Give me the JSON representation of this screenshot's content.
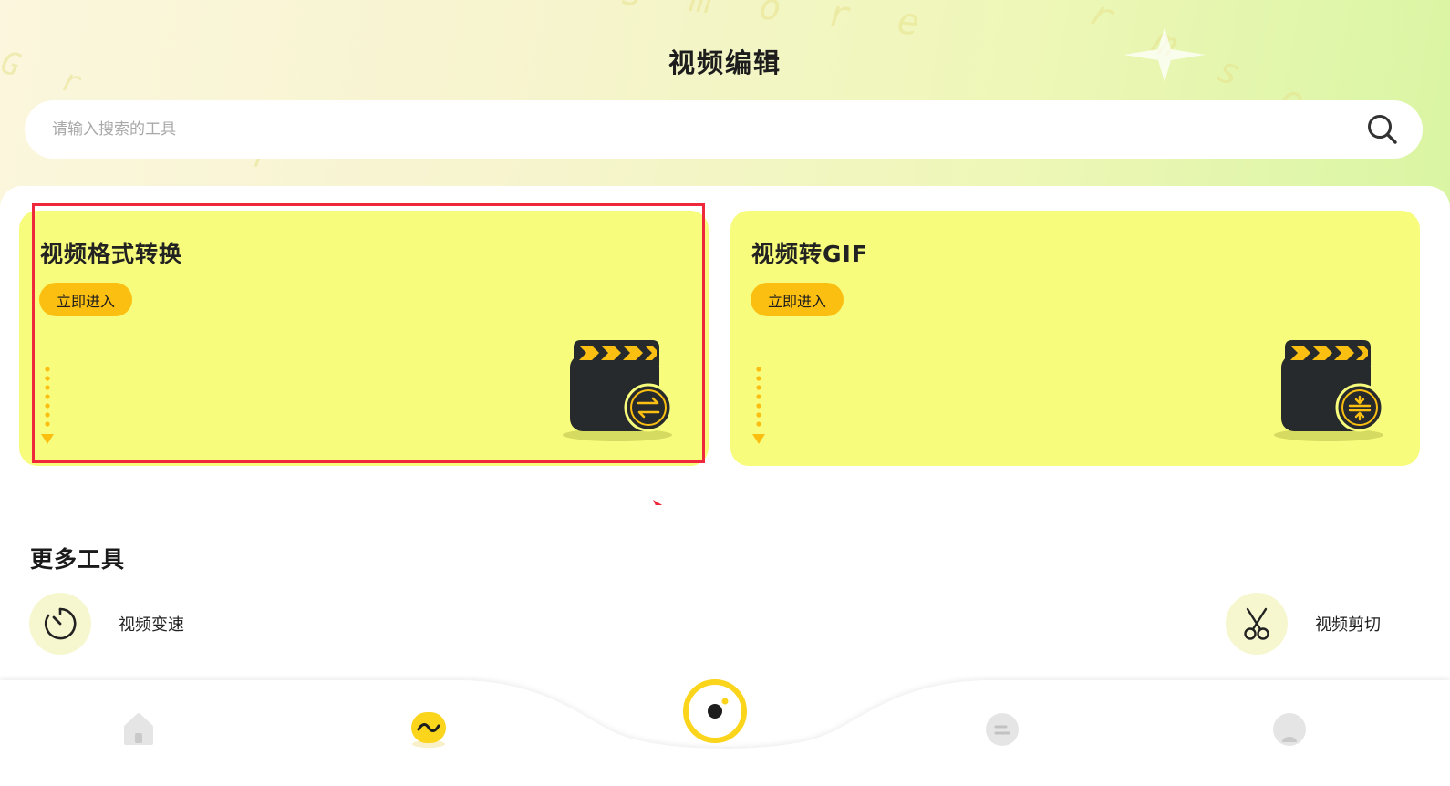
{
  "header": {
    "title": "视频编辑",
    "decor_words": [
      "s m o r e",
      "f o r m s o",
      "G r",
      "o u r"
    ]
  },
  "search": {
    "placeholder": "请输入搜索的工具"
  },
  "feature_cards": [
    {
      "title": "视频格式转换",
      "button_label": "立即进入",
      "icon": "clapperboard-convert-icon"
    },
    {
      "title": "视频转GIF",
      "button_label": "立即进入",
      "icon": "clapperboard-compress-icon"
    }
  ],
  "more_tools": {
    "title": "更多工具",
    "items": [
      {
        "label": "视频变速",
        "icon": "speed-timer-icon"
      },
      {
        "label": "视频剪切",
        "icon": "scissors-icon"
      }
    ]
  },
  "tab_bar": {
    "active_index": 1,
    "items": [
      {
        "icon": "home-icon"
      },
      {
        "icon": "wave-icon"
      },
      {
        "icon": "camera-record-icon"
      },
      {
        "icon": "message-icon"
      },
      {
        "icon": "profile-icon"
      }
    ]
  },
  "colors": {
    "card_background": "#f8fc7c",
    "button_background": "#fbbf12",
    "accent_yellow": "#fbd41c",
    "highlight_red": "#f0283c"
  }
}
